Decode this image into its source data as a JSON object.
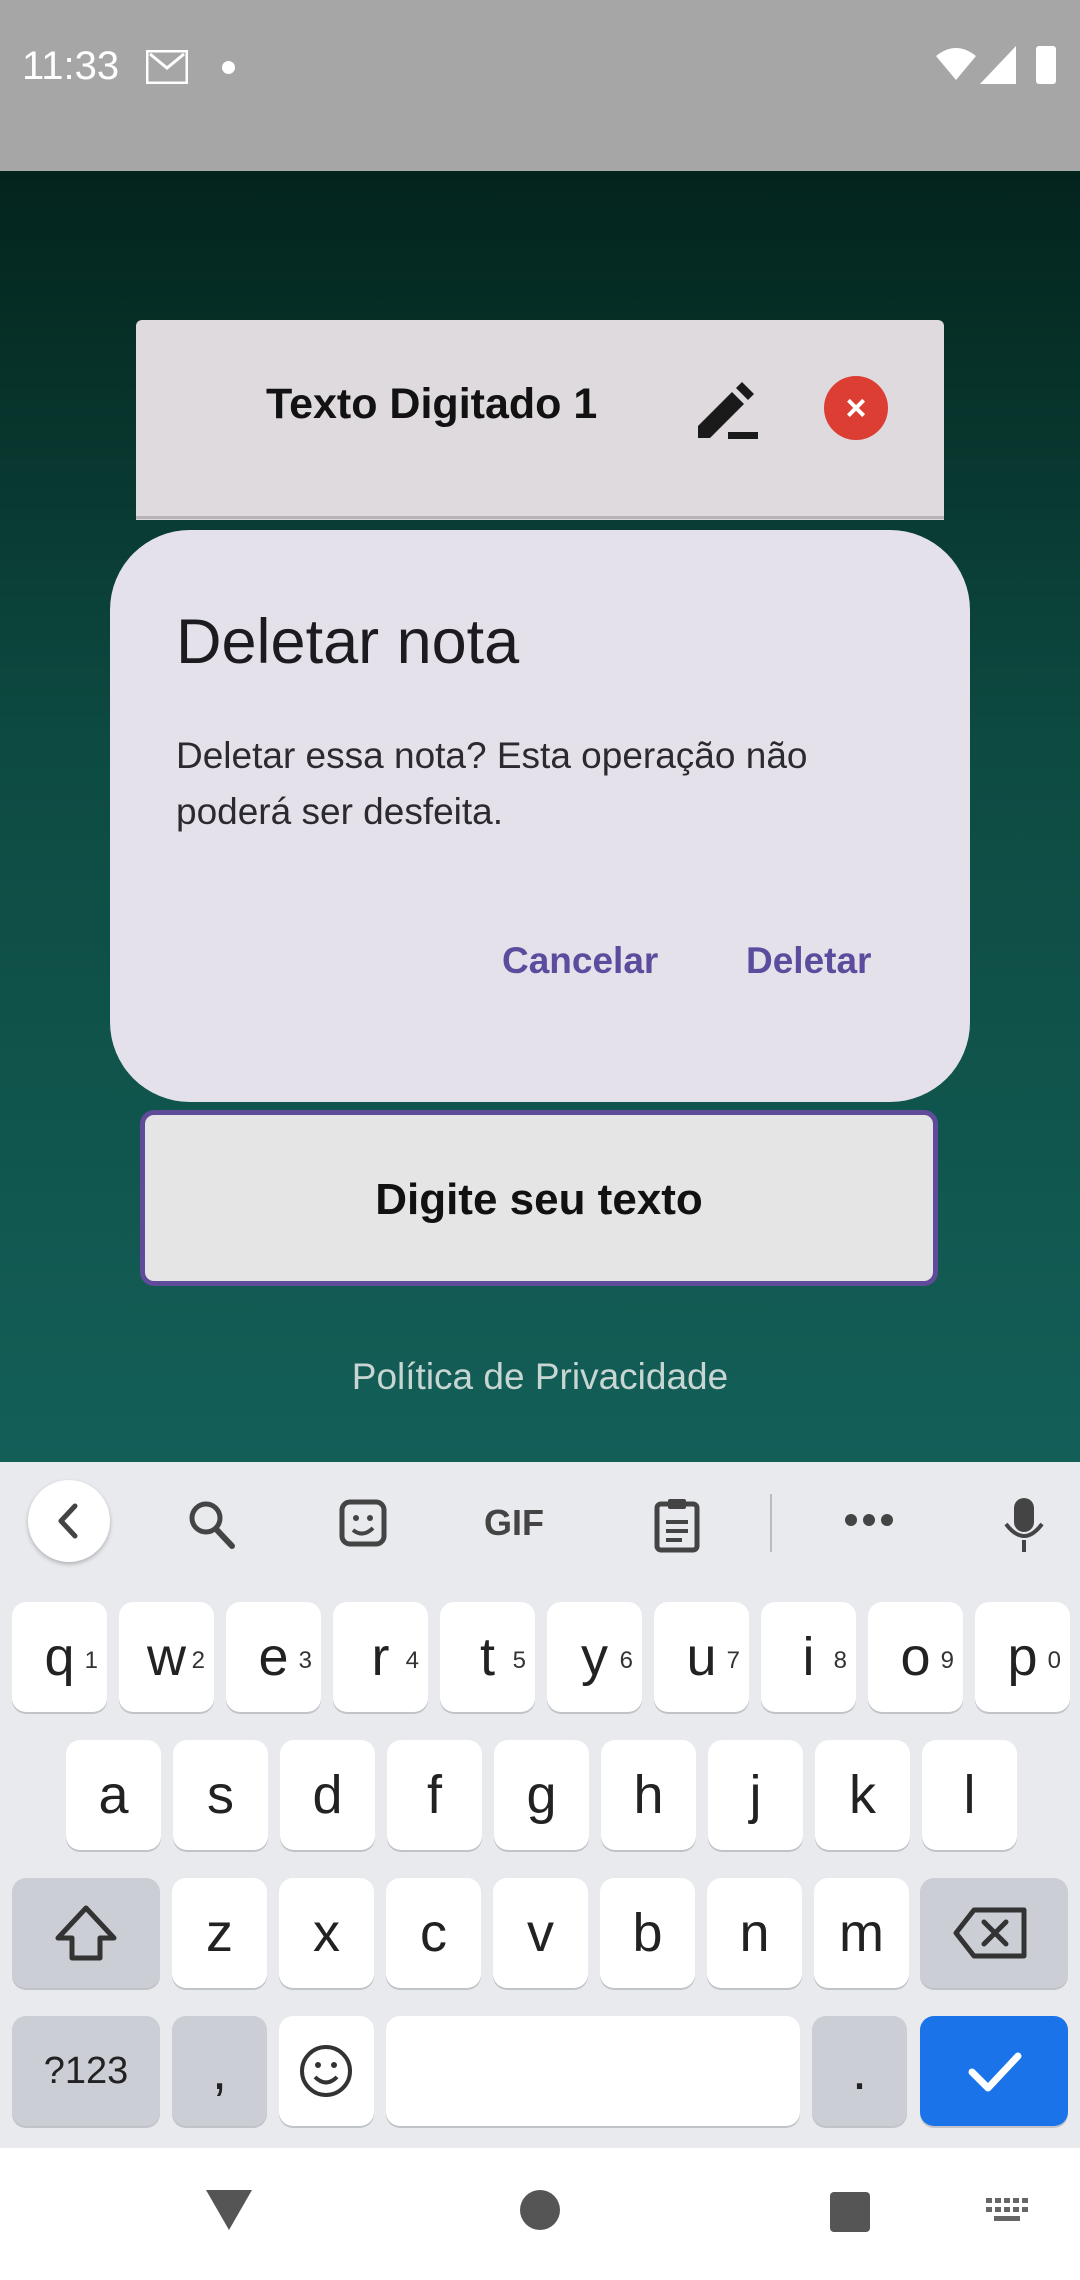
{
  "status_bar": {
    "time": "11:33"
  },
  "note_card": {
    "title": "Texto Digitado 1"
  },
  "dialog": {
    "title": "Deletar nota",
    "message": "Deletar essa nota? Esta operação não poderá ser desfeita.",
    "cancel_label": "Cancelar",
    "delete_label": "Deletar"
  },
  "input_button": {
    "label": "Digite seu texto"
  },
  "footer": {
    "privacy_link": "Política de Privacidade"
  },
  "keyboard": {
    "toolbar": {
      "gif_label": "GIF"
    },
    "row1": [
      {
        "k": "q",
        "h": "1"
      },
      {
        "k": "w",
        "h": "2"
      },
      {
        "k": "e",
        "h": "3"
      },
      {
        "k": "r",
        "h": "4"
      },
      {
        "k": "t",
        "h": "5"
      },
      {
        "k": "y",
        "h": "6"
      },
      {
        "k": "u",
        "h": "7"
      },
      {
        "k": "i",
        "h": "8"
      },
      {
        "k": "o",
        "h": "9"
      },
      {
        "k": "p",
        "h": "0"
      }
    ],
    "row2": [
      "a",
      "s",
      "d",
      "f",
      "g",
      "h",
      "j",
      "k",
      "l"
    ],
    "row3": [
      "z",
      "x",
      "c",
      "v",
      "b",
      "n",
      "m"
    ],
    "symbols_label": "?123",
    "comma": ",",
    "period": ".",
    "accent_color": "#1a73e8"
  },
  "colors": {
    "dialog_accent": "#5d4b9e",
    "close_red": "#dd3e34"
  }
}
